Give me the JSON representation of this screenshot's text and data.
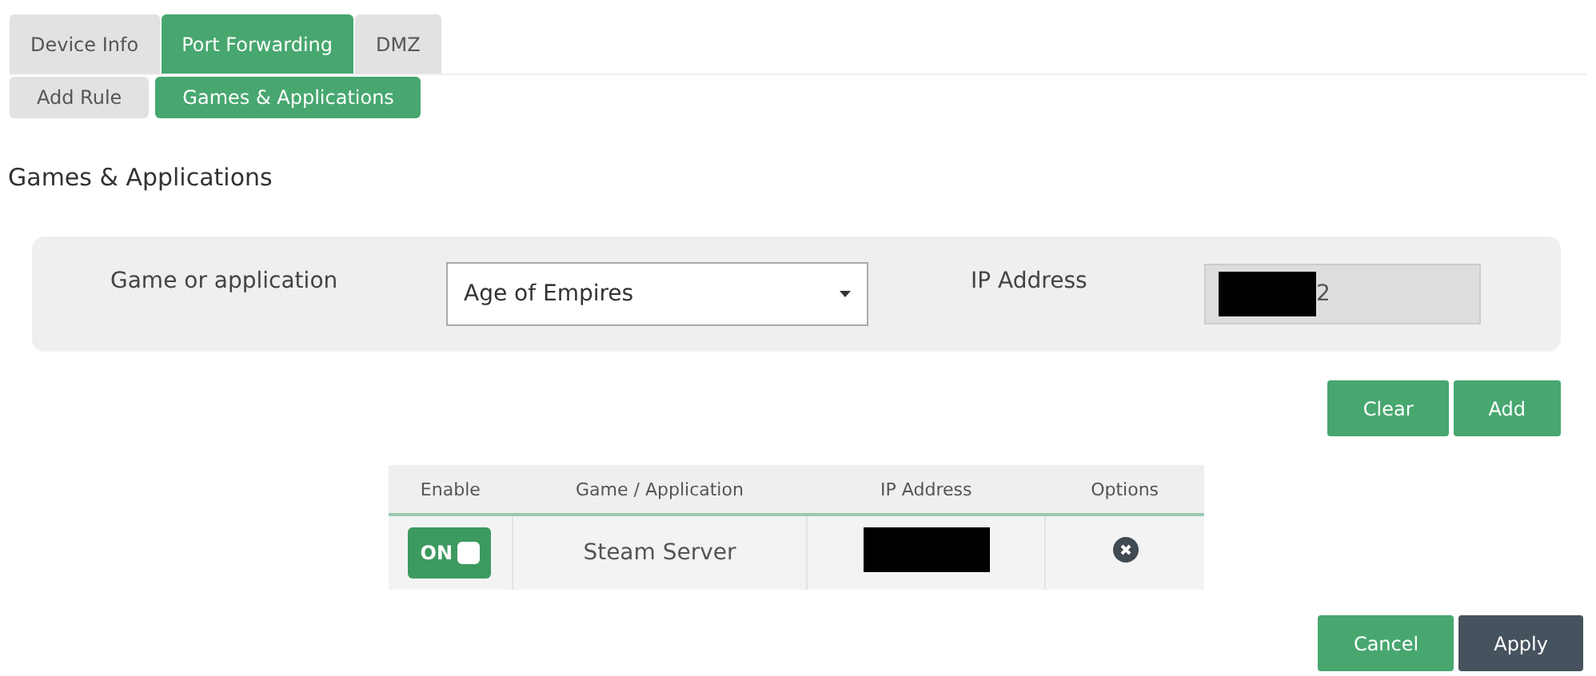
{
  "tabs": [
    {
      "label": "Device Info",
      "selected": false
    },
    {
      "label": "Port Forwarding",
      "selected": true
    },
    {
      "label": "DMZ",
      "selected": false
    }
  ],
  "subtabs": [
    {
      "label": "Add Rule",
      "selected": false
    },
    {
      "label": "Games & Applications",
      "selected": true
    }
  ],
  "heading": "Games & Applications",
  "form": {
    "game_label": "Game or application",
    "game_value": "Age of Empires",
    "ip_label": "IP Address",
    "ip_value": "2",
    "ip_redacted": true
  },
  "form_buttons": [
    "Clear",
    "Add"
  ],
  "table": {
    "columns": [
      "Enable",
      "Game / Application",
      "IP Address",
      "Options"
    ],
    "rows": [
      {
        "enable_label": "ON",
        "on": true,
        "game": "Steam Server",
        "ip_redacted": true
      }
    ]
  },
  "footer_buttons": [
    {
      "label": "Cancel",
      "kind": "primary"
    },
    {
      "label": "Apply",
      "kind": "dark"
    }
  ]
}
